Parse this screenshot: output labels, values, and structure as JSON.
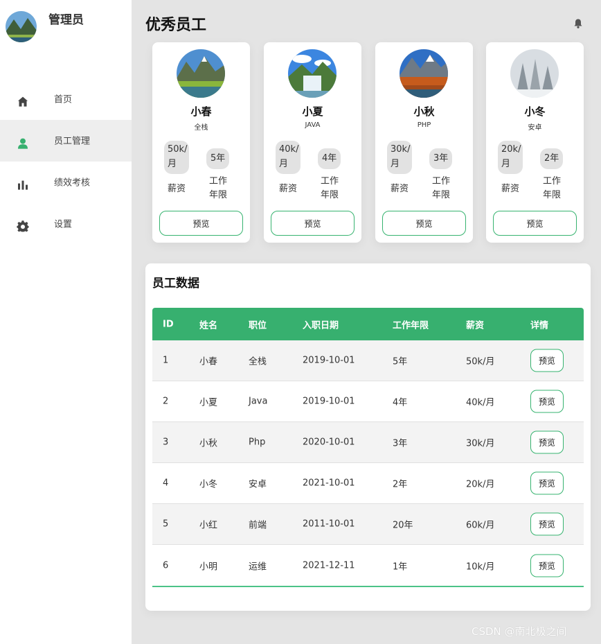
{
  "sidebar": {
    "profile_name": "管理员",
    "items": [
      {
        "label": "首页",
        "icon": "home-icon"
      },
      {
        "label": "员工管理",
        "icon": "user-icon",
        "active": true
      },
      {
        "label": "绩效考核",
        "icon": "bar-chart-icon"
      },
      {
        "label": "设置",
        "icon": "gear-icon"
      }
    ]
  },
  "header": {
    "title": "优秀员工",
    "icon": "bell-icon"
  },
  "colors": {
    "accent": "#37b06f",
    "active_icon": "#37b06f",
    "sidebar_bg": "#ffffff",
    "page_bg": "#e4e4e4"
  },
  "cards": [
    {
      "name": "小春",
      "role": "全栈",
      "salary": "50k/月",
      "years": "5年",
      "salary_label": "薪资",
      "years_label": "工作年限",
      "button": "预览"
    },
    {
      "name": "小夏",
      "role": "JAVA",
      "salary": "40k/月",
      "years": "4年",
      "salary_label": "薪资",
      "years_label": "工作年限",
      "button": "预览"
    },
    {
      "name": "小秋",
      "role": "PHP",
      "salary": "30k/月",
      "years": "3年",
      "salary_label": "薪资",
      "years_label": "工作年限",
      "button": "预览"
    },
    {
      "name": "小冬",
      "role": "安卓",
      "salary": "20k/月",
      "years": "2年",
      "salary_label": "薪资",
      "years_label": "工作年限",
      "button": "预览"
    }
  ],
  "table": {
    "title": "员工数据",
    "headers": [
      "ID",
      "姓名",
      "职位",
      "入职日期",
      "工作年限",
      "薪资",
      "详情"
    ],
    "rows": [
      {
        "id": "1",
        "name": "小春",
        "role": "全栈",
        "date": "2019-10-01",
        "years": "5年",
        "salary": "50k/月",
        "button": "预览"
      },
      {
        "id": "2",
        "name": "小夏",
        "role": "Java",
        "date": "2019-10-01",
        "years": "4年",
        "salary": "40k/月",
        "button": "预览"
      },
      {
        "id": "3",
        "name": "小秋",
        "role": "Php",
        "date": "2020-10-01",
        "years": "3年",
        "salary": "30k/月",
        "button": "预览"
      },
      {
        "id": "4",
        "name": "小冬",
        "role": "安卓",
        "date": "2021-10-01",
        "years": "2年",
        "salary": "20k/月",
        "button": "预览"
      },
      {
        "id": "5",
        "name": "小红",
        "role": "前端",
        "date": "2011-10-01",
        "years": "20年",
        "salary": "60k/月",
        "button": "预览"
      },
      {
        "id": "6",
        "name": "小明",
        "role": "运维",
        "date": "2021-12-11",
        "years": "1年",
        "salary": "10k/月",
        "button": "预览"
      }
    ]
  },
  "watermark": "CSDN @南北极之间"
}
